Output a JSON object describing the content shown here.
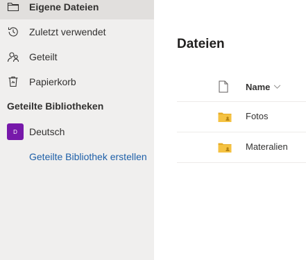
{
  "sidebar": {
    "items": [
      {
        "label": "Eigene Dateien",
        "icon": "folder-outline-icon",
        "active": true
      },
      {
        "label": "Zuletzt verwendet",
        "icon": "history-icon"
      },
      {
        "label": "Geteilt",
        "icon": "shared-people-icon"
      },
      {
        "label": "Papierkorb",
        "icon": "recycle-bin-icon"
      }
    ],
    "shared_libraries_header": "Geteilte Bibliotheken",
    "libraries": [
      {
        "label": "Deutsch",
        "badge_text": "D",
        "badge_color": "#7719aa"
      }
    ],
    "create_library_link": "Geteilte Bibliothek erstellen"
  },
  "main": {
    "title": "Dateien",
    "columns": {
      "name": "Name"
    },
    "files": [
      {
        "name": "Fotos",
        "type": "shared-folder"
      },
      {
        "name": "Materalien",
        "type": "shared-folder"
      }
    ]
  },
  "colors": {
    "sidebar_bg": "#f0efee",
    "active_item_bg": "#e1dfdd",
    "link": "#1d5fa8",
    "folder": "#f5c242"
  }
}
